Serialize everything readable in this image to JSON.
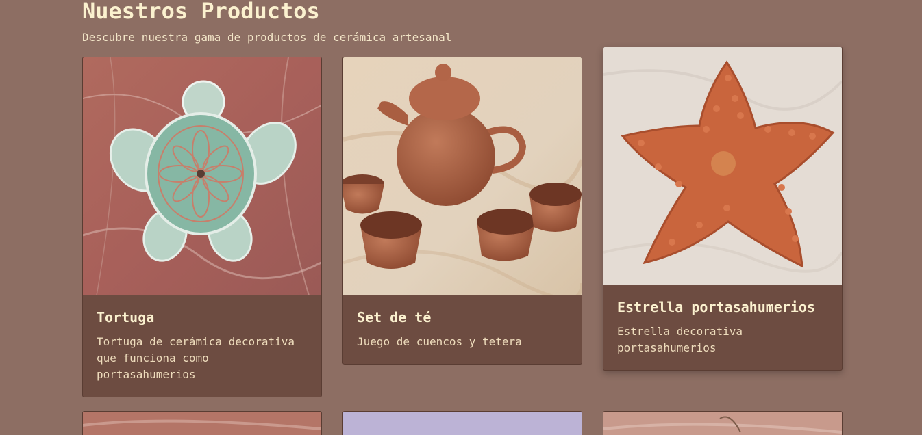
{
  "header": {
    "title": "Nuestros Productos",
    "subtitle": "Descubre nuestra gama de productos de cerámica artesanal"
  },
  "products": [
    {
      "title": "Tortuga",
      "description": "Tortuga de cerámica decorativa que funciona como portasahumerios",
      "image": "turtle-image"
    },
    {
      "title": "Set de té",
      "description": "Juego de cuencos y tetera",
      "image": "tea-set-image"
    },
    {
      "title": "Estrella portasahumerios",
      "description": "Estrella decorativa portasahumerios",
      "image": "starfish-image"
    }
  ],
  "colors": {
    "background": "#8d6e63",
    "card": "#6d4c41",
    "text": "#fbf1cf"
  }
}
